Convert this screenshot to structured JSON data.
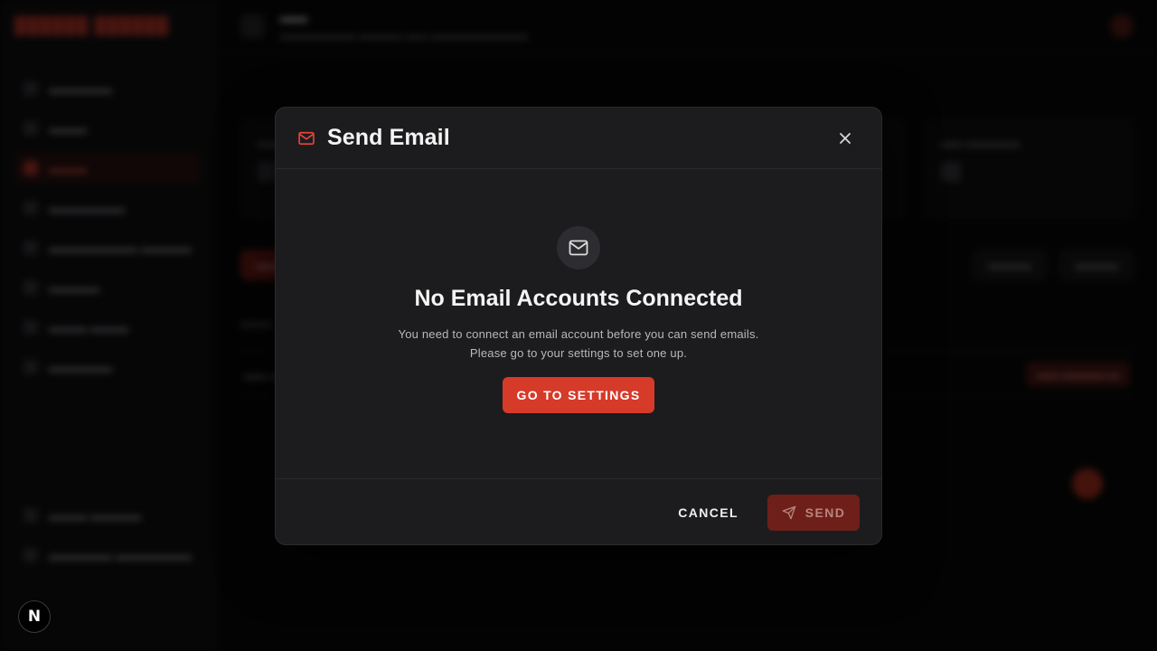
{
  "background": {
    "brand": "██████ ██████",
    "nav": [
      "▬▬▬▬▬",
      "▬▬▬",
      "▬▬▬",
      "▬▬▬▬▬▬",
      "▬▬▬▬▬▬▬ ▬▬▬▬",
      "▬▬▬▬",
      "▬▬▬ ▬▬▬",
      "▬▬▬▬▬"
    ],
    "active_nav_index": 2,
    "bottom_nav": [
      "▬▬▬ ▬▬▬▬",
      "▬▬▬▬▬ ▬▬▬▬▬▬"
    ],
    "topbar_title": "▬▬",
    "topbar_sub": "▬▬▬▬▬▬▬ ▬▬▬▬ ▬▬ ▬▬▬▬▬▬▬▬▬",
    "card_label": "▬▬ ▬▬▬▬▬",
    "toolbar": [
      "▬▬▬",
      "▬▬▬▬",
      "▬▬▬▬"
    ],
    "row_chip": "▬▬ ▬▬▬▬ ▬"
  },
  "dev_badge": {
    "label": "N"
  },
  "modal": {
    "title": "Send Email",
    "header_icon": "mail-icon",
    "accent": "#d63a29",
    "empty_state": {
      "icon": "mail-icon",
      "title": "No Email Accounts Connected",
      "text": "You need to connect an email account before you can send emails. Please go to your settings to set one up."
    },
    "go_to_settings_label": "GO TO SETTINGS",
    "cancel_label": "CANCEL",
    "send_label": "SEND",
    "send_icon": "send-icon",
    "send_disabled": true
  }
}
